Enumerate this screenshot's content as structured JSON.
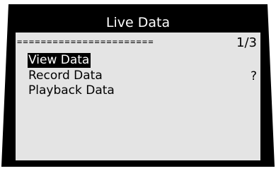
{
  "screen": {
    "title": "Live Data",
    "separator": "=======================",
    "page_indicator": "1/3",
    "help_mark": "?",
    "menu": [
      {
        "label": "View Data",
        "selected": true
      },
      {
        "label": "Record Data",
        "selected": false
      },
      {
        "label": "Playback Data",
        "selected": false
      }
    ]
  },
  "colors": {
    "screen_bg": "#e4e4e4",
    "highlight_bg": "#000000",
    "highlight_text": "#ffffff",
    "bezel": "#000000"
  }
}
